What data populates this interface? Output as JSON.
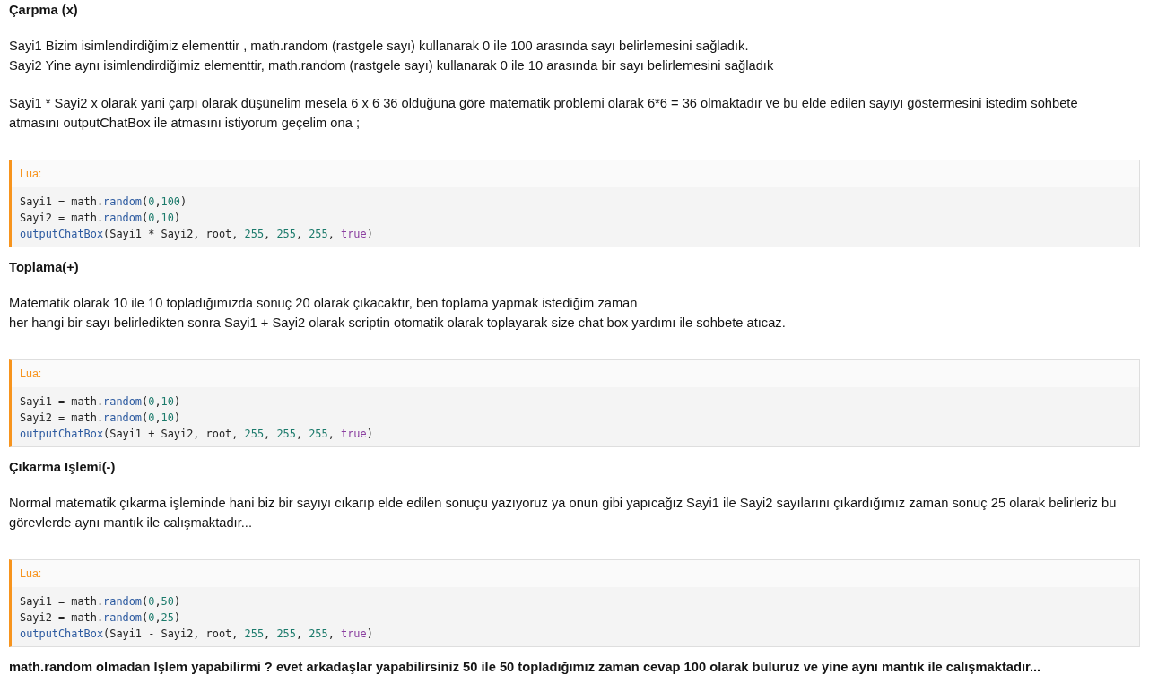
{
  "blocks": [
    {
      "kind": "heading",
      "text": "Çarpma (x)"
    },
    {
      "kind": "paragraph",
      "lines": [
        "Sayi1 Bizim isimlendirdiğimiz elementtir , math.random (rastgele sayı) kullanarak 0 ile 100 arasında sayı belirlemesini sağladık.",
        "Sayi2 Yine aynı isimlendirdiğimiz elementtir, math.random (rastgele sayı) kullanarak 0 ile 10 arasında bir sayı belirlemesini sağladık"
      ]
    },
    {
      "kind": "paragraph",
      "lines": [
        "Sayi1 * Sayi2 x olarak yani çarpı olarak düşünelim mesela 6 x 6 36 olduğuna göre matematik problemi olarak 6*6 = 36 olmaktadır ve bu elde edilen sayıyı göstermesini istedim sohbete atmasını outputChatBox ile atmasını istiyorum geçelim ona ;"
      ]
    },
    {
      "kind": "code",
      "label": "Lua:",
      "lines": [
        [
          {
            "text": "Sayi1 = math.",
            "kind": "plain"
          },
          {
            "text": "random",
            "kind": "func"
          },
          {
            "text": "(",
            "kind": "plain"
          },
          {
            "text": "0",
            "kind": "num"
          },
          {
            "text": ",",
            "kind": "plain"
          },
          {
            "text": "100",
            "kind": "num"
          },
          {
            "text": ")",
            "kind": "plain"
          }
        ],
        [
          {
            "text": "Sayi2 = math.",
            "kind": "plain"
          },
          {
            "text": "random",
            "kind": "func"
          },
          {
            "text": "(",
            "kind": "plain"
          },
          {
            "text": "0",
            "kind": "num"
          },
          {
            "text": ",",
            "kind": "plain"
          },
          {
            "text": "10",
            "kind": "num"
          },
          {
            "text": ")",
            "kind": "plain"
          }
        ],
        [
          {
            "text": "outputChatBox",
            "kind": "func"
          },
          {
            "text": "(Sayi1 * Sayi2, root, ",
            "kind": "plain"
          },
          {
            "text": "255",
            "kind": "num"
          },
          {
            "text": ", ",
            "kind": "plain"
          },
          {
            "text": "255",
            "kind": "num"
          },
          {
            "text": ", ",
            "kind": "plain"
          },
          {
            "text": "255",
            "kind": "num"
          },
          {
            "text": ", ",
            "kind": "plain"
          },
          {
            "text": "true",
            "kind": "bool"
          },
          {
            "text": ")",
            "kind": "plain"
          }
        ]
      ]
    },
    {
      "kind": "heading",
      "text": "Toplama(+)"
    },
    {
      "kind": "paragraph",
      "lines": [
        "Matematik olarak 10 ile 10 topladığımızda sonuç 20 olarak çıkacaktır, ben toplama yapmak istediğim zaman",
        "her hangi bir sayı belirledikten sonra Sayi1 + Sayi2 olarak scriptin otomatik olarak toplayarak size chat box yardımı ile sohbete atıcaz."
      ]
    },
    {
      "kind": "code",
      "label": "Lua:",
      "lines": [
        [
          {
            "text": "Sayi1 = math.",
            "kind": "plain"
          },
          {
            "text": "random",
            "kind": "func"
          },
          {
            "text": "(",
            "kind": "plain"
          },
          {
            "text": "0",
            "kind": "num"
          },
          {
            "text": ",",
            "kind": "plain"
          },
          {
            "text": "10",
            "kind": "num"
          },
          {
            "text": ")",
            "kind": "plain"
          }
        ],
        [
          {
            "text": "Sayi2 = math.",
            "kind": "plain"
          },
          {
            "text": "random",
            "kind": "func"
          },
          {
            "text": "(",
            "kind": "plain"
          },
          {
            "text": "0",
            "kind": "num"
          },
          {
            "text": ",",
            "kind": "plain"
          },
          {
            "text": "10",
            "kind": "num"
          },
          {
            "text": ")",
            "kind": "plain"
          }
        ],
        [
          {
            "text": "outputChatBox",
            "kind": "func"
          },
          {
            "text": "(Sayi1 + Sayi2, root, ",
            "kind": "plain"
          },
          {
            "text": "255",
            "kind": "num"
          },
          {
            "text": ", ",
            "kind": "plain"
          },
          {
            "text": "255",
            "kind": "num"
          },
          {
            "text": ", ",
            "kind": "plain"
          },
          {
            "text": "255",
            "kind": "num"
          },
          {
            "text": ", ",
            "kind": "plain"
          },
          {
            "text": "true",
            "kind": "bool"
          },
          {
            "text": ")",
            "kind": "plain"
          }
        ]
      ]
    },
    {
      "kind": "heading",
      "text": "Çıkarma Işlemi(-)"
    },
    {
      "kind": "paragraph",
      "lines": [
        "Normal matematik çıkarma işleminde hani biz bir sayıyı cıkarıp elde edilen sonuçu yazıyoruz ya onun gibi yapıcağız Sayi1 ile Sayi2 sayılarını çıkardığımız zaman sonuç 25 olarak belirleriz bu görevlerde aynı mantık ile calışmaktadır..."
      ]
    },
    {
      "kind": "code",
      "label": "Lua:",
      "lines": [
        [
          {
            "text": "Sayi1 = math.",
            "kind": "plain"
          },
          {
            "text": "random",
            "kind": "func"
          },
          {
            "text": "(",
            "kind": "plain"
          },
          {
            "text": "0",
            "kind": "num"
          },
          {
            "text": ",",
            "kind": "plain"
          },
          {
            "text": "50",
            "kind": "num"
          },
          {
            "text": ")",
            "kind": "plain"
          }
        ],
        [
          {
            "text": "Sayi2 = math.",
            "kind": "plain"
          },
          {
            "text": "random",
            "kind": "func"
          },
          {
            "text": "(",
            "kind": "plain"
          },
          {
            "text": "0",
            "kind": "num"
          },
          {
            "text": ",",
            "kind": "plain"
          },
          {
            "text": "25",
            "kind": "num"
          },
          {
            "text": ")",
            "kind": "plain"
          }
        ],
        [
          {
            "text": "outputChatBox",
            "kind": "func"
          },
          {
            "text": "(Sayi1 - Sayi2, root, ",
            "kind": "plain"
          },
          {
            "text": "255",
            "kind": "num"
          },
          {
            "text": ", ",
            "kind": "plain"
          },
          {
            "text": "255",
            "kind": "num"
          },
          {
            "text": ", ",
            "kind": "plain"
          },
          {
            "text": "255",
            "kind": "num"
          },
          {
            "text": ", ",
            "kind": "plain"
          },
          {
            "text": "true",
            "kind": "bool"
          },
          {
            "text": ")",
            "kind": "plain"
          }
        ]
      ]
    },
    {
      "kind": "heading",
      "text": "math.random olmadan Işlem yapabilirmi ? evet arkadaşlar yapabilirsiniz 50 ile 50 topladığımız zaman cevap 100 olarak buluruz ve yine aynı mantık ile calışmaktadır..."
    }
  ]
}
